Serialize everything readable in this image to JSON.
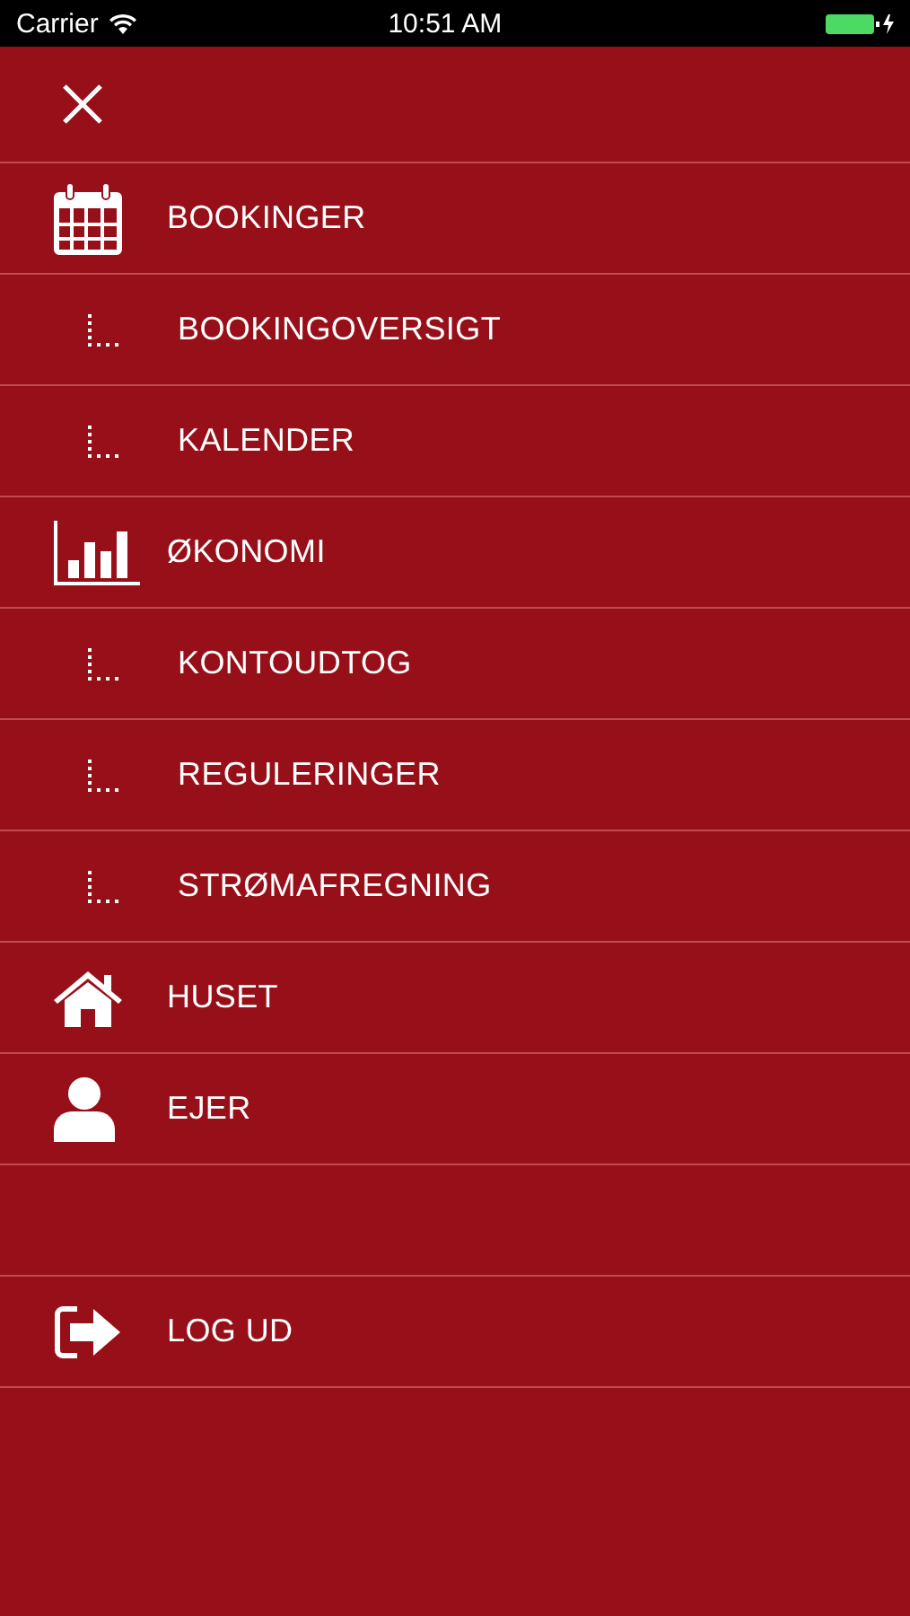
{
  "status_bar": {
    "carrier": "Carrier",
    "time": "10:51 AM"
  },
  "menu": [
    {
      "kind": "calendar",
      "label": "BOOKINGER"
    },
    {
      "kind": "sub",
      "label": "BOOKINGOVERSIGT"
    },
    {
      "kind": "sub",
      "label": "KALENDER"
    },
    {
      "kind": "chart",
      "label": "ØKONOMI"
    },
    {
      "kind": "sub",
      "label": "KONTOUDTOG"
    },
    {
      "kind": "sub",
      "label": "REGULERINGER"
    },
    {
      "kind": "sub",
      "label": "STRØMAFREGNING"
    },
    {
      "kind": "home",
      "label": "HUSET"
    },
    {
      "kind": "user",
      "label": "EJER"
    },
    {
      "kind": "spacer"
    },
    {
      "kind": "logout",
      "label": "LOG UD"
    }
  ]
}
